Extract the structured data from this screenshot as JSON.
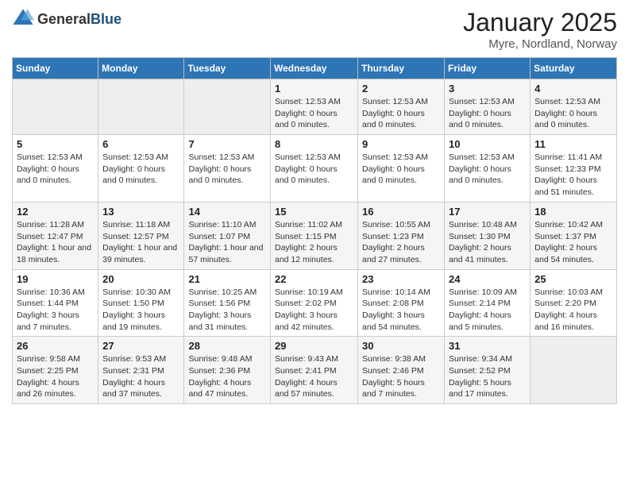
{
  "header": {
    "logo": {
      "text_general": "General",
      "text_blue": "Blue"
    },
    "title": "January 2025",
    "subtitle": "Myre, Nordland, Norway"
  },
  "calendar": {
    "weekdays": [
      "Sunday",
      "Monday",
      "Tuesday",
      "Wednesday",
      "Thursday",
      "Friday",
      "Saturday"
    ],
    "weeks": [
      [
        {
          "day": "",
          "info": ""
        },
        {
          "day": "",
          "info": ""
        },
        {
          "day": "",
          "info": ""
        },
        {
          "day": "1",
          "info": "Sunset: 12:53 AM\nDaylight: 0 hours and 0 minutes."
        },
        {
          "day": "2",
          "info": "Sunset: 12:53 AM\nDaylight: 0 hours and 0 minutes."
        },
        {
          "day": "3",
          "info": "Sunset: 12:53 AM\nDaylight: 0 hours and 0 minutes."
        },
        {
          "day": "4",
          "info": "Sunset: 12:53 AM\nDaylight: 0 hours and 0 minutes."
        }
      ],
      [
        {
          "day": "5",
          "info": "Sunset: 12:53 AM\nDaylight: 0 hours and 0 minutes."
        },
        {
          "day": "6",
          "info": "Sunset: 12:53 AM\nDaylight: 0 hours and 0 minutes."
        },
        {
          "day": "7",
          "info": "Sunset: 12:53 AM\nDaylight: 0 hours and 0 minutes."
        },
        {
          "day": "8",
          "info": "Sunset: 12:53 AM\nDaylight: 0 hours and 0 minutes."
        },
        {
          "day": "9",
          "info": "Sunset: 12:53 AM\nDaylight: 0 hours and 0 minutes."
        },
        {
          "day": "10",
          "info": "Sunset: 12:53 AM\nDaylight: 0 hours and 0 minutes."
        },
        {
          "day": "11",
          "info": "Sunrise: 11:41 AM\nSunset: 12:33 PM\nDaylight: 0 hours and 51 minutes."
        }
      ],
      [
        {
          "day": "12",
          "info": "Sunrise: 11:28 AM\nSunset: 12:47 PM\nDaylight: 1 hour and 18 minutes."
        },
        {
          "day": "13",
          "info": "Sunrise: 11:18 AM\nSunset: 12:57 PM\nDaylight: 1 hour and 39 minutes."
        },
        {
          "day": "14",
          "info": "Sunrise: 11:10 AM\nSunset: 1:07 PM\nDaylight: 1 hour and 57 minutes."
        },
        {
          "day": "15",
          "info": "Sunrise: 11:02 AM\nSunset: 1:15 PM\nDaylight: 2 hours and 12 minutes."
        },
        {
          "day": "16",
          "info": "Sunrise: 10:55 AM\nSunset: 1:23 PM\nDaylight: 2 hours and 27 minutes."
        },
        {
          "day": "17",
          "info": "Sunrise: 10:48 AM\nSunset: 1:30 PM\nDaylight: 2 hours and 41 minutes."
        },
        {
          "day": "18",
          "info": "Sunrise: 10:42 AM\nSunset: 1:37 PM\nDaylight: 2 hours and 54 minutes."
        }
      ],
      [
        {
          "day": "19",
          "info": "Sunrise: 10:36 AM\nSunset: 1:44 PM\nDaylight: 3 hours and 7 minutes."
        },
        {
          "day": "20",
          "info": "Sunrise: 10:30 AM\nSunset: 1:50 PM\nDaylight: 3 hours and 19 minutes."
        },
        {
          "day": "21",
          "info": "Sunrise: 10:25 AM\nSunset: 1:56 PM\nDaylight: 3 hours and 31 minutes."
        },
        {
          "day": "22",
          "info": "Sunrise: 10:19 AM\nSunset: 2:02 PM\nDaylight: 3 hours and 42 minutes."
        },
        {
          "day": "23",
          "info": "Sunrise: 10:14 AM\nSunset: 2:08 PM\nDaylight: 3 hours and 54 minutes."
        },
        {
          "day": "24",
          "info": "Sunrise: 10:09 AM\nSunset: 2:14 PM\nDaylight: 4 hours and 5 minutes."
        },
        {
          "day": "25",
          "info": "Sunrise: 10:03 AM\nSunset: 2:20 PM\nDaylight: 4 hours and 16 minutes."
        }
      ],
      [
        {
          "day": "26",
          "info": "Sunrise: 9:58 AM\nSunset: 2:25 PM\nDaylight: 4 hours and 26 minutes."
        },
        {
          "day": "27",
          "info": "Sunrise: 9:53 AM\nSunset: 2:31 PM\nDaylight: 4 hours and 37 minutes."
        },
        {
          "day": "28",
          "info": "Sunrise: 9:48 AM\nSunset: 2:36 PM\nDaylight: 4 hours and 47 minutes."
        },
        {
          "day": "29",
          "info": "Sunrise: 9:43 AM\nSunset: 2:41 PM\nDaylight: 4 hours and 57 minutes."
        },
        {
          "day": "30",
          "info": "Sunrise: 9:38 AM\nSunset: 2:46 PM\nDaylight: 5 hours and 7 minutes."
        },
        {
          "day": "31",
          "info": "Sunrise: 9:34 AM\nSunset: 2:52 PM\nDaylight: 5 hours and 17 minutes."
        },
        {
          "day": "",
          "info": ""
        }
      ]
    ]
  }
}
